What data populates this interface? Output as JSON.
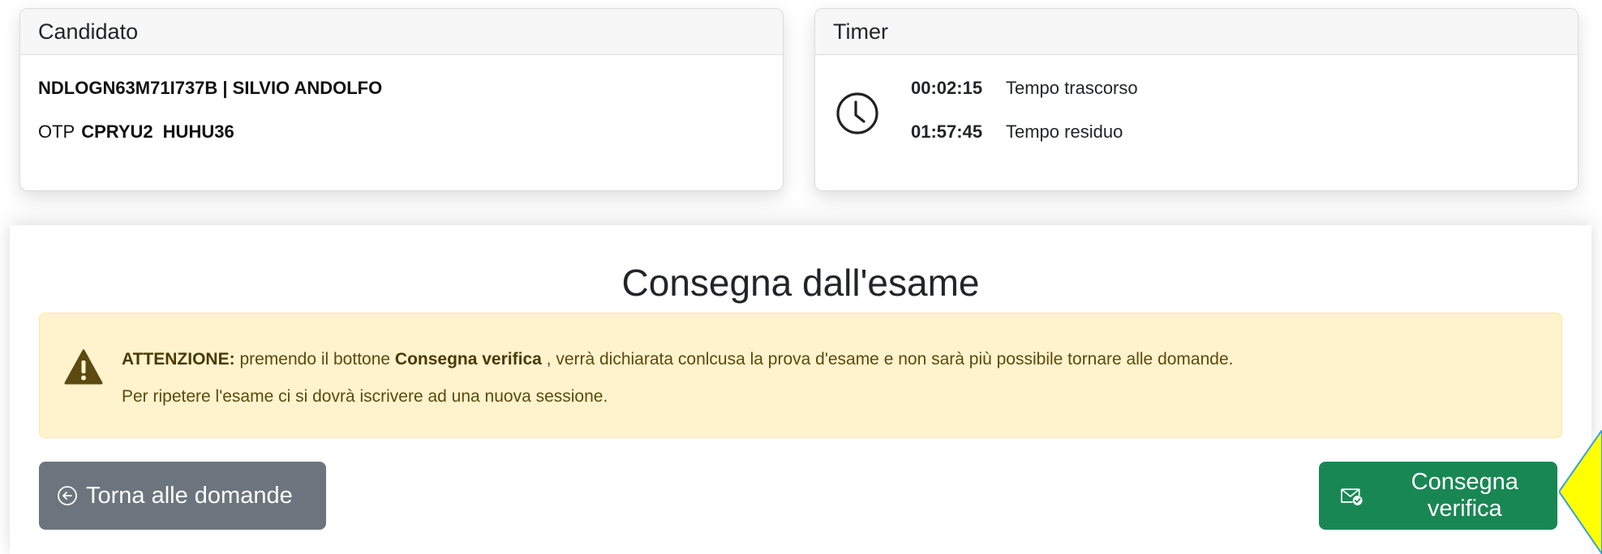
{
  "candidate_card": {
    "header": "Candidato",
    "id_name": "NDLOGN63M71I737B | SILVIO ANDOLFO",
    "otp_label": "OTP",
    "otp_codes": [
      "CPRYU2",
      "HUHU36"
    ]
  },
  "timer_card": {
    "header": "Timer",
    "icon": "clock-icon",
    "elapsed_value": "00:02:15",
    "elapsed_label": "Tempo trascorso",
    "remaining_value": "01:57:45",
    "remaining_label": "Tempo residuo"
  },
  "main": {
    "title": "Consegna dall'esame",
    "alert": {
      "icon": "warning-icon",
      "bold_prefix": "ATTENZIONE:",
      "text_a": " premendo il bottone ",
      "bold_button_ref": "Consegna verifica",
      "text_b": " , verrà dichiarata conlcusa la prova d'esame e non sarà più possibile tornare alle domande.",
      "line2": "Per ripetere l'esame ci si dovrà iscrivere ad una nuova sessione."
    },
    "back_button": {
      "icon": "arrow-left-circle-icon",
      "label": "Torna alle domande"
    },
    "submit_button": {
      "icon": "envelope-check-icon",
      "label": "Consegna verifica"
    }
  },
  "colors": {
    "alert_bg": "#fff3cd",
    "back_button_bg": "#6c757d",
    "submit_button_bg": "#198754",
    "annotation_arrow": "#ffff00"
  }
}
